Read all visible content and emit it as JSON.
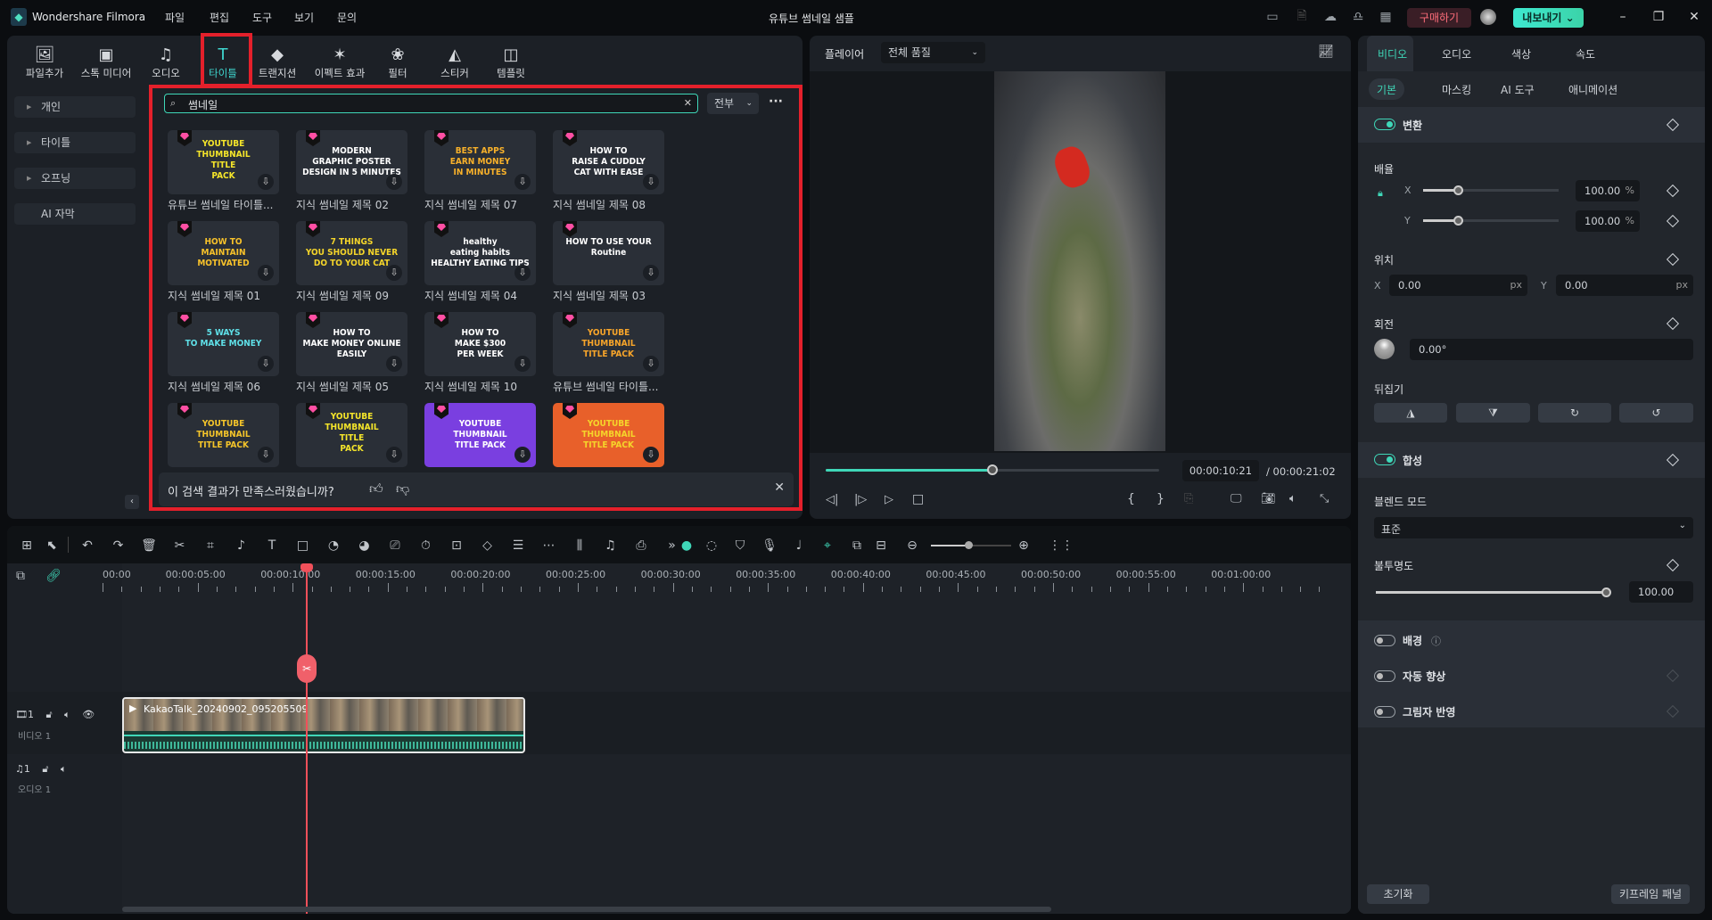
{
  "app": {
    "name": "Wondershare Filmora",
    "project_title": "유튜브 썸네일 샘플",
    "menu": [
      "파일",
      "편집",
      "도구",
      "보기",
      "문의"
    ],
    "buy_label": "구매하기",
    "export_label": "내보내기",
    "accent": "#3fd7b8",
    "highlight": "#e4202b"
  },
  "media_toolbar": [
    {
      "label": "파일추가",
      "icon": "import-icon",
      "glyph": "🖼"
    },
    {
      "label": "스톡 미디어",
      "icon": "stock-media-icon",
      "glyph": "▣"
    },
    {
      "label": "오디오",
      "icon": "music-icon",
      "glyph": "♫"
    },
    {
      "label": "타이틀",
      "icon": "title-icon",
      "glyph": "T",
      "active": true
    },
    {
      "label": "트랜지션",
      "icon": "transition-icon",
      "glyph": "◆"
    },
    {
      "label": "이펙트 효과",
      "icon": "effects-icon",
      "glyph": "✶"
    },
    {
      "label": "필터",
      "icon": "filter-icon",
      "glyph": "❀"
    },
    {
      "label": "스티커",
      "icon": "sticker-icon",
      "glyph": "◭"
    },
    {
      "label": "템플릿",
      "icon": "template-icon",
      "glyph": "◫"
    }
  ],
  "sidebar": [
    {
      "label": "개인",
      "arrow": true
    },
    {
      "label": "타이틀",
      "arrow": true
    },
    {
      "label": "오프닝",
      "arrow": true
    },
    {
      "label": "AI 자막",
      "arrow": false
    }
  ],
  "search": {
    "value": "썸네일",
    "filter": "전부"
  },
  "results": [
    {
      "label": "유튜브 썸네일 타이틀...",
      "art": [
        "YOUTUBE",
        "THUMBNAIL",
        "TITLE",
        "PACK"
      ],
      "fg": "#f5e52a",
      "bg": "#2a2f37"
    },
    {
      "label": "지식 썸네일 제목 02",
      "art": [
        "MODERN",
        "GRAPHIC POSTER",
        "DESIGN IN 5 MINUTES"
      ],
      "fg": "#ffffff",
      "bg": "#2a2f37"
    },
    {
      "label": "지식 썸네일 제목 07",
      "art": [
        "BEST APPS",
        "EARN MONEY",
        "IN MINUTES"
      ],
      "fg": "#f8b12a",
      "bg": "#2a2f37"
    },
    {
      "label": "지식 썸네일 제목 08",
      "art": [
        "HOW TO",
        "RAISE A CUDDLY",
        "CAT WITH EASE"
      ],
      "fg": "#ffffff",
      "bg": "#2a2f37"
    },
    {
      "label": "지식 썸네일 제목 01",
      "art": [
        "HOW TO",
        "MAINTAIN",
        "MOTIVATED"
      ],
      "fg": "#f8c22a",
      "bg": "#2a2f37"
    },
    {
      "label": "지식 썸네일 제목 09",
      "art": [
        "7 THINGS",
        "YOU SHOULD NEVER",
        "DO TO YOUR CAT"
      ],
      "fg": "#f5d52a",
      "bg": "#2a2f37"
    },
    {
      "label": "지식 썸네일 제목 04",
      "art": [
        "healthy",
        "eating habits",
        "HEALTHY EATING TIPS"
      ],
      "fg": "#ffffff",
      "bg": "#2a2f37"
    },
    {
      "label": "지식 썸네일 제목 03",
      "art": [
        "HOW TO USE YOUR",
        "Routine"
      ],
      "fg": "#ffffff",
      "bg": "#2a2f37"
    },
    {
      "label": "지식 썸네일 제목 06",
      "art": [
        "5 WAYS",
        "TO MAKE MONEY"
      ],
      "fg": "#5fe0e8",
      "bg": "#2a2f37"
    },
    {
      "label": "지식 썸네일 제목 05",
      "art": [
        "HOW TO",
        "MAKE MONEY ONLINE",
        "EASILY"
      ],
      "fg": "#ffffff",
      "bg": "#2a2f37"
    },
    {
      "label": "지식 썸네일 제목 10",
      "art": [
        "HOW TO",
        "MAKE $300",
        "PER WEEK"
      ],
      "fg": "#ffffff",
      "bg": "#2a2f37"
    },
    {
      "label": "유튜브 썸네일 타이틀...",
      "art": [
        "YOUTUBE",
        "THUMBNAIL",
        "TITLE PACK"
      ],
      "fg": "#f8a52a",
      "bg": "#2a2f37"
    },
    {
      "label": "",
      "art": [
        "YOUTUBE",
        "THUMBNAIL",
        "TITLE PACK"
      ],
      "fg": "#f5c52a",
      "bg": "#2a2f37"
    },
    {
      "label": "",
      "art": [
        "YOUTUBE",
        "THUMBNAIL",
        "TITLE",
        "PACK"
      ],
      "fg": "#f5e52a",
      "bg": "#2a2f37"
    },
    {
      "label": "",
      "art": [
        "YOUTUBE",
        "THUMBNAIL",
        "TITLE PACK"
      ],
      "fg": "#ffffff",
      "bg": "#7a3fe0"
    },
    {
      "label": "",
      "art": [
        "YOUTUBE",
        "THUMBNAIL",
        "TITLE PACK"
      ],
      "fg": "#f5d52a",
      "bg": "#e8602a"
    }
  ],
  "feedback": {
    "question": "이 검색 결과가 만족스러웠습니까?"
  },
  "player": {
    "label": "플레이어",
    "quality": "전체 품질",
    "current_time": "00:00:10:21",
    "total_time": "/ 00:00:21:02",
    "progress": 0.5
  },
  "props": {
    "tabs": [
      "비디오",
      "오디오",
      "색상",
      "속도"
    ],
    "subtabs": [
      "기본",
      "마스킹",
      "AI 도구",
      "애니메이션"
    ],
    "transform": {
      "title": "변환",
      "enabled": true,
      "scale_label": "배율",
      "scale_x": "100.00",
      "scale_y": "100.00",
      "unit_pct": "%",
      "pos_label": "위치",
      "pos_x": "0.00",
      "pos_y": "0.00",
      "unit_px": "px",
      "rotate_label": "회전",
      "rotate": "0.00°",
      "flip_label": "뒤집기",
      "x": "X",
      "y": "Y"
    },
    "composite": {
      "title": "합성",
      "enabled": true,
      "blend_label": "블렌드 모드",
      "blend_value": "표준",
      "opacity_label": "불투명도",
      "opacity": "100.00",
      "opacity_fraction": 1
    },
    "toggles": [
      {
        "label": "배경",
        "on": false,
        "help": true
      },
      {
        "label": "자동 향상",
        "on": false
      },
      {
        "label": "그림자 반영",
        "on": false
      }
    ],
    "reset_label": "초기화",
    "keyframe_label": "키프레임 패널"
  },
  "timeline": {
    "ruler": [
      "00:00",
      "00:00:05:00",
      "00:00:10:00",
      "00:00:15:00",
      "00:00:20:00",
      "00:00:25:00",
      "00:00:30:00",
      "00:00:35:00",
      "00:00:40:00",
      "00:00:45:00",
      "00:00:50:00",
      "00:00:55:00",
      "00:01:00:00"
    ],
    "playhead_seconds": 10.7,
    "clip_name": "KakaoTalk_20240902_095205509",
    "video_track": {
      "index": "1",
      "name": "비디오 1"
    },
    "audio_track": {
      "index": "1",
      "name": "오디오 1"
    },
    "tools": [
      "grid-icon",
      "select-icon",
      "undo-icon",
      "redo-icon",
      "delete-icon",
      "cut-icon",
      "crop-icon",
      "audio-detach-icon",
      "text-icon",
      "shape-icon",
      "speed-icon",
      "color-icon",
      "mask-icon",
      "timer-icon",
      "reframe-icon",
      "keyframe-icon",
      "adjust-icon",
      "freeze-icon",
      "audio-wave-icon",
      "ducking-icon",
      "tts-icon",
      "more-icon"
    ],
    "tools_right": [
      "ai-mate-icon",
      "render-icon",
      "marker-icon",
      "record-icon",
      "music-beat-icon",
      "snap-icon",
      "pip-icon",
      "fit-icon",
      "zoom-out-icon",
      "zoom-slider",
      "zoom-in-icon",
      "layout-icon"
    ]
  }
}
